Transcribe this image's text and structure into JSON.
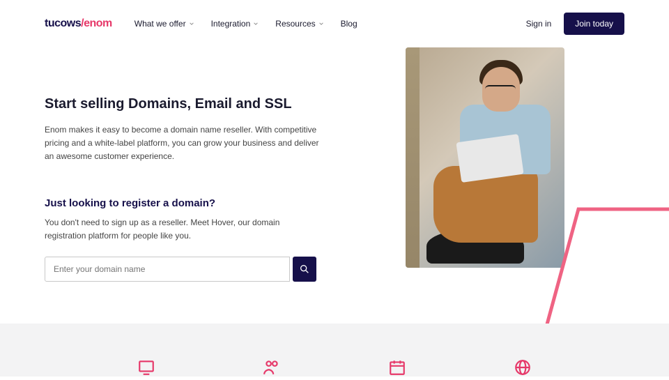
{
  "logo": {
    "part1": "tucows",
    "slash": "/",
    "part2": "enom"
  },
  "nav": [
    {
      "label": "What we offer",
      "dropdown": true
    },
    {
      "label": "Integration",
      "dropdown": true
    },
    {
      "label": "Resources",
      "dropdown": true
    },
    {
      "label": "Blog",
      "dropdown": false
    }
  ],
  "header": {
    "signin": "Sign in",
    "join": "Join today"
  },
  "hero": {
    "title": "Start selling Domains, Email and SSL",
    "desc": "Enom makes it easy to become a domain name reseller. With competitive pricing and a white-label platform, you can grow your business and deliver an awesome customer experience.",
    "subtitle": "Just looking to register a domain?",
    "subdesc": "You don't need to sign up as a reseller. Meet Hover, our domain registration platform for people like you.",
    "search_placeholder": "Enter your domain name"
  }
}
